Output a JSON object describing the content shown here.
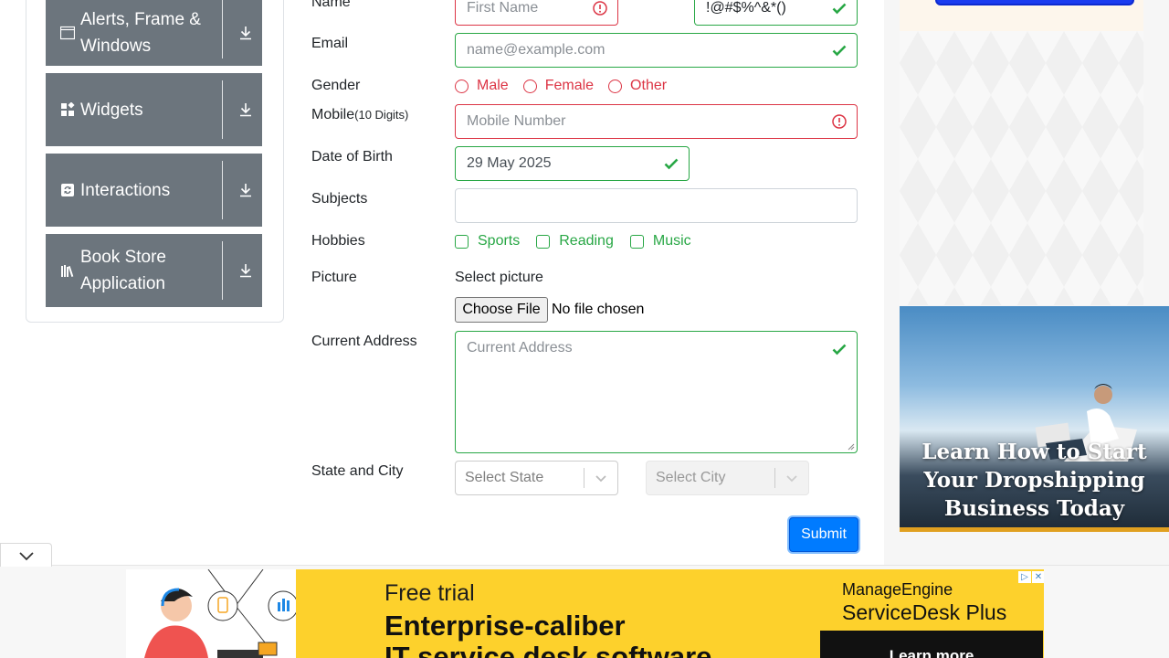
{
  "sidebar": {
    "groups": [
      {
        "label": "Alerts, Frame & Windows",
        "icon": "window-icon"
      },
      {
        "label": "Widgets",
        "icon": "widgets-icon"
      },
      {
        "label": "Interactions",
        "icon": "interactions-icon"
      },
      {
        "label": "Book Store Application",
        "icon": "books-icon"
      }
    ]
  },
  "form": {
    "name_label": "Name",
    "first_name_placeholder": "First Name",
    "last_name_value": "!@#$%^&*()",
    "email_label": "Email",
    "email_placeholder": "name@example.com",
    "gender_label": "Gender",
    "gender_options": [
      "Male",
      "Female",
      "Other"
    ],
    "mobile_label": "Mobile",
    "mobile_hint": "(10 Digits)",
    "mobile_placeholder": "Mobile Number",
    "dob_label": "Date of Birth",
    "dob_value": "29 May 2025",
    "subjects_label": "Subjects",
    "hobbies_label": "Hobbies",
    "hobbies_options": [
      "Sports",
      "Reading",
      "Music"
    ],
    "picture_label": "Picture",
    "select_picture": "Select picture",
    "choose_file_button": "Choose File",
    "no_file": "No file chosen",
    "address_label": "Current Address",
    "address_placeholder": "Current Address",
    "state_city_label": "State and City",
    "state_placeholder": "Select State",
    "city_placeholder": "Select City",
    "submit_label": "Submit"
  },
  "promo": {
    "title": "Learn How to Start Your Dropshipping Business Today"
  },
  "banner": {
    "free_trial": "Free trial",
    "headline_1": "Enterprise-caliber",
    "headline_2": "IT service desk software",
    "brand_1": "ManageEngine",
    "brand_2": "ServiceDesk Plus",
    "cta": "Learn more"
  },
  "colors": {
    "valid": "#28a745",
    "invalid": "#dc3545",
    "primary": "#007bff",
    "sidebar_group": "#6c757d",
    "banner": "#fdd12c"
  }
}
